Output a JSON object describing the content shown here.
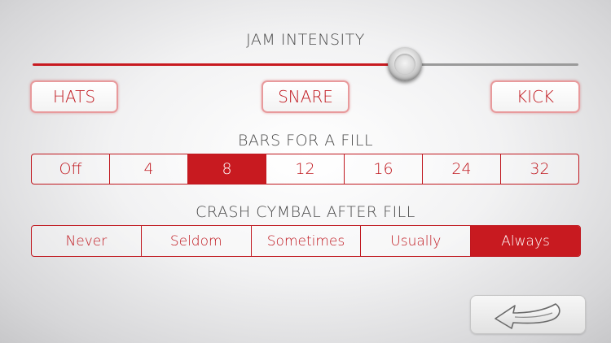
{
  "jam_intensity": {
    "title": "JAM INTENSITY",
    "value_fraction": 0.68
  },
  "drum_buttons": {
    "hats": "HATS",
    "snare": "SNARE",
    "kick": "KICK"
  },
  "bars_for_fill": {
    "title": "BARS FOR A FILL",
    "options": [
      "Off",
      "4",
      "8",
      "12",
      "16",
      "24",
      "32"
    ],
    "selected": "8"
  },
  "crash_cymbal": {
    "title": "CRASH CYMBAL AFTER FILL",
    "options": [
      "Never",
      "Seldom",
      "Sometimes",
      "Usually",
      "Always"
    ],
    "selected": "Always"
  },
  "back_button": {
    "icon": "back-arrow-icon"
  },
  "colors": {
    "accent": "#c81a20",
    "heading_text": "#4a4a4a",
    "background": "#f0f0f1"
  }
}
